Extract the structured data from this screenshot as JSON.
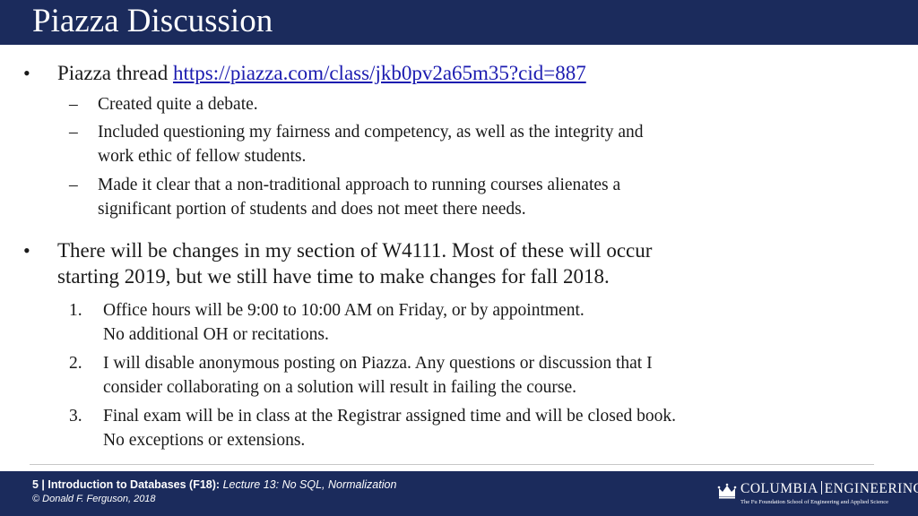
{
  "slide": {
    "title": "Piazza Discussion",
    "bullet1": {
      "text": "Piazza thread ",
      "link": "https://piazza.com/class/jkb0pv2a65m35?cid=887",
      "subitems": [
        "Created quite a debate.",
        "Included questioning my fairness and competency, as well as the integrity and",
        "work ethic of fellow students.",
        "Made it clear that a non-traditional approach to running courses alienates a",
        "significant portion of students and does not meet there needs."
      ]
    },
    "bullet2": {
      "line1": "There will be changes in my section of W4111. Most of these will occur",
      "line2": "starting 2019, but we still have time to make changes for fall 2018.",
      "items": [
        {
          "num": "1.",
          "lines": [
            "Office hours will be 9:00 to 10:00 AM on Friday, or by appointment.",
            "No additional OH or recitations."
          ]
        },
        {
          "num": "2.",
          "lines": [
            "I will disable anonymous posting on Piazza. Any questions or discussion that I",
            "consider collaborating on a solution will result in failing the course."
          ]
        },
        {
          "num": "3.",
          "lines": [
            "Final exam will be in class at the Registrar assigned time and will be closed book.",
            "No exceptions or extensions."
          ]
        }
      ]
    },
    "bullet_symbol": "•",
    "dash_symbol": "–"
  },
  "footer": {
    "page_prefix": "5 | ",
    "course": "Introduction to Databases (F18):",
    "lecture": " Lecture 13: No SQL, Normalization",
    "copyright": "© Donald F. Ferguson, 2018",
    "logo_left": "COLUMBIA",
    "logo_right": "ENGINEERING",
    "logo_sub": "The Fu Foundation School of Engineering and Applied Science"
  },
  "colors": {
    "bar": "#1b2b5c",
    "link": "#1b1bb0"
  }
}
